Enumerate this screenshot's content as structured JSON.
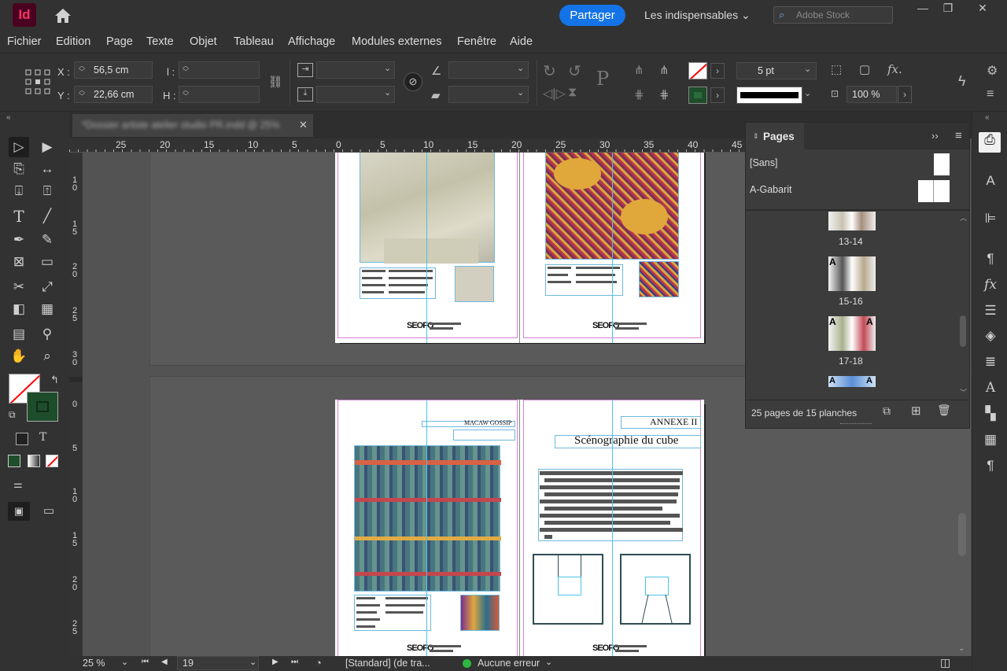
{
  "app": {
    "logo": "Id",
    "share_label": "Partager",
    "workspace": "Les indispensables",
    "stock_placeholder": "Adobe Stock",
    "window_min": "—",
    "window_restore": "❐",
    "window_close": "✕"
  },
  "menu": [
    "Fichier",
    "Edition",
    "Page",
    "Texte",
    "Objet",
    "Tableau",
    "Affichage",
    "Modules externes",
    "Fenêtre",
    "Aide"
  ],
  "control": {
    "x_label": "X :",
    "x_value": "56,5 cm",
    "y_label": "Y :",
    "y_value": "22,66 cm",
    "w_label": "l :",
    "h_label": "H :",
    "stroke_weight": "5 pt",
    "zoom_scale": "100 %"
  },
  "doc_tab": {
    "title": "*Dossier artiste atelier studio PR.indd @ 25%",
    "close": "✕"
  },
  "ruler_h": [
    "25",
    "20",
    "15",
    "10",
    "5",
    "0",
    "5",
    "10",
    "15",
    "20",
    "25",
    "30",
    "35",
    "40",
    "45"
  ],
  "ruler_v_top": [
    "1 0",
    "1 5",
    "2 0",
    "2 5",
    "3 0"
  ],
  "ruler_v_bottom": [
    "0",
    "5",
    "1 0",
    "1 5",
    "2 0",
    "2 5"
  ],
  "spread2": {
    "header_left": "MACAW GOSSIP",
    "header_right": "ANNEXE II",
    "title": "Scénographie du cube"
  },
  "footer_logo": "SEOFO",
  "pages_panel": {
    "title": "Pages",
    "masters": [
      "[Sans]",
      "A-Gabarit"
    ],
    "spreads": [
      {
        "label": "13-14",
        "prefix": ""
      },
      {
        "label": "15-16",
        "prefix": "A"
      },
      {
        "label": "17-18",
        "prefix": "A"
      },
      {
        "label": "",
        "prefix": "A"
      }
    ],
    "footer": "25 pages de 15 planches"
  },
  "status": {
    "zoom": "25 %",
    "page": "19",
    "preflight_profile": "[Standard] (de tra...",
    "errors": "Aucune erreur"
  },
  "colors": {
    "accent": "#1473e6",
    "fill_swatch": "#1e4d2b",
    "stroke_none": "#ff0000",
    "guide": "#48c4e8",
    "margin": "#d47fd4",
    "status_ok": "#2db842"
  }
}
